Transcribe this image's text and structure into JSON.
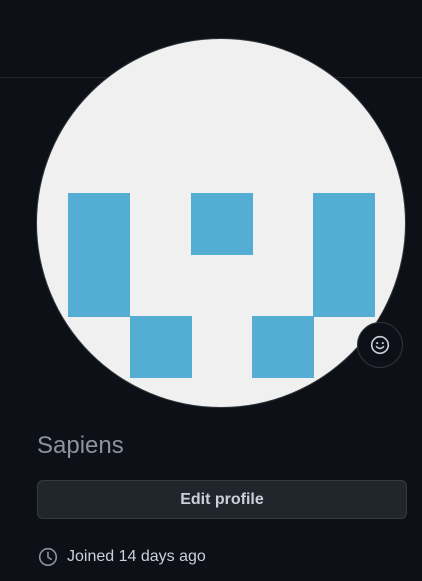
{
  "profile": {
    "display_name": "Sapiens",
    "edit_profile_label": "Edit profile",
    "joined_text": "Joined 14 days ago",
    "avatar_color": "#54aed4",
    "avatar_background": "#f0f0f0"
  },
  "icons": {
    "status": "smiley-icon",
    "joined": "clock-icon"
  }
}
